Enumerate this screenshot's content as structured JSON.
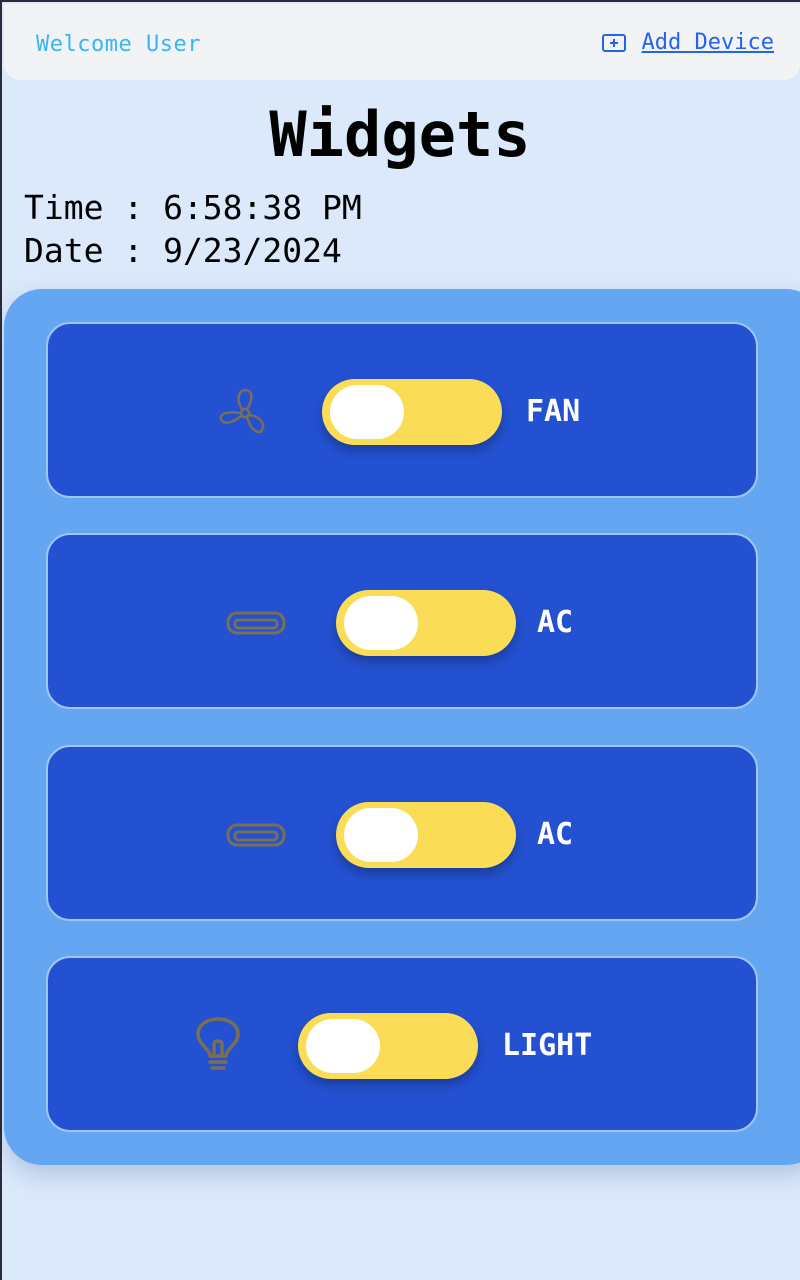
{
  "header": {
    "welcome": "Welcome User",
    "add_device": "Add Device"
  },
  "page": {
    "title": "Widgets",
    "time_line": "Time : 6:58:38 PM",
    "date_line": "Date : 9/23/2024"
  },
  "devices": [
    {
      "label": "FAN",
      "icon": "fan-icon",
      "state": "off"
    },
    {
      "label": "AC",
      "icon": "air-conditioner-icon",
      "state": "off"
    },
    {
      "label": "AC",
      "icon": "air-conditioner-icon",
      "state": "off"
    },
    {
      "label": "LIGHT",
      "icon": "lightbulb-icon",
      "state": "off"
    }
  ],
  "colors": {
    "background": "#dbe9fb",
    "panel": "#65a6f2",
    "card": "#2351d1",
    "toggle": "#fbdc57",
    "link": "#2563eb",
    "welcome": "#38b6f1",
    "icon": "#7a6f55"
  }
}
